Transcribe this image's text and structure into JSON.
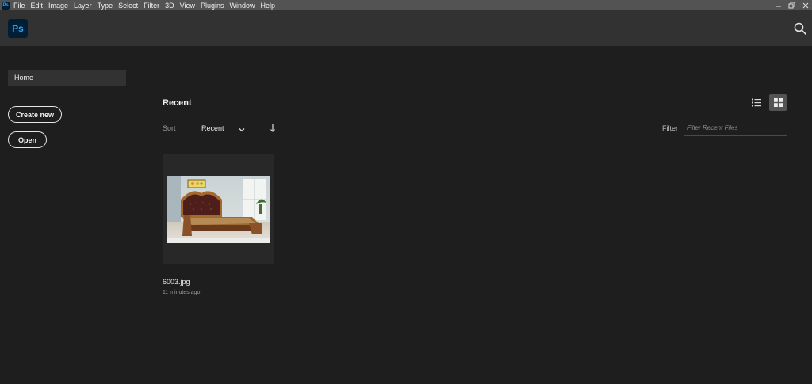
{
  "app": {
    "logo_text": "Ps",
    "brand_color": "#31a8ff",
    "logo_bg": "#001e36"
  },
  "menubar": {
    "items": [
      "File",
      "Edit",
      "Image",
      "Layer",
      "Type",
      "Select",
      "Filter",
      "3D",
      "View",
      "Plugins",
      "Window",
      "Help"
    ]
  },
  "header": {
    "search_icon": "search-icon"
  },
  "sidebar": {
    "home_label": "Home",
    "create_new_label": "Create new",
    "open_label": "Open"
  },
  "main": {
    "title": "Recent",
    "sort_label": "Sort",
    "sort_value": "Recent",
    "filter_label": "Filter",
    "filter_placeholder": "Filter Recent Files",
    "view_modes": [
      "list-view-icon",
      "grid-view-icon"
    ],
    "active_view": "grid"
  },
  "files": [
    {
      "name": "6003.jpg",
      "modified": "11 minutes ago",
      "thumbnail": "bed-photo"
    }
  ]
}
